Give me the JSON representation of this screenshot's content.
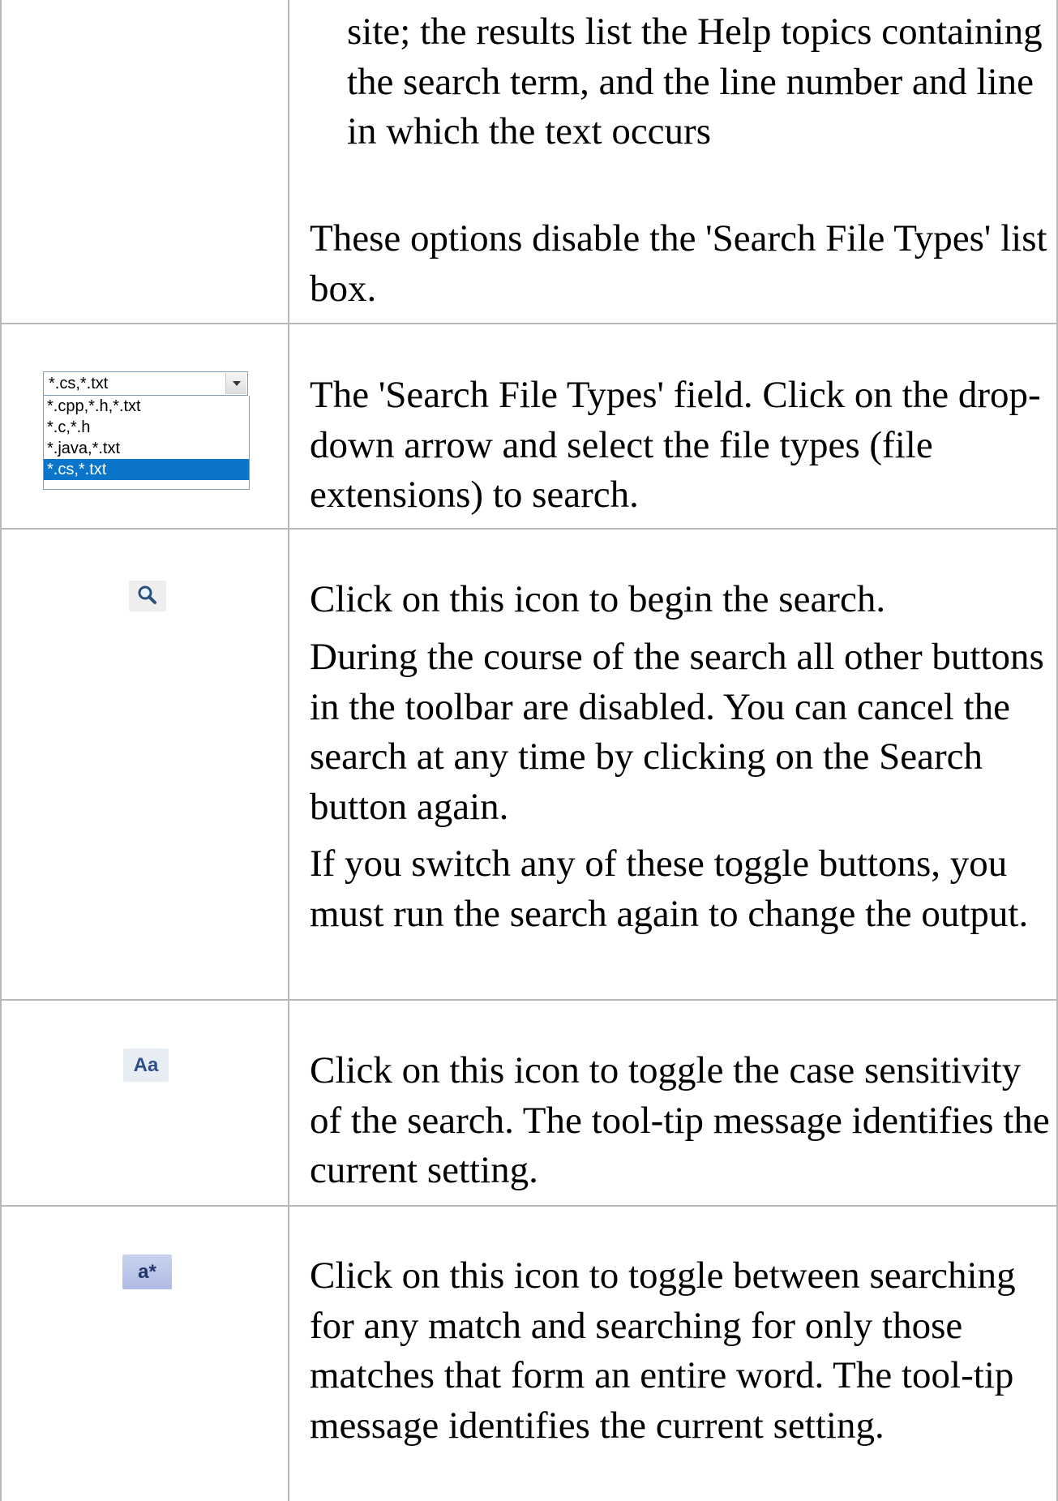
{
  "rows": [
    {
      "paragraphs": [
        "site; the results list the Help topics containing the search term, and the line number and line in which the text occurs",
        "These options disable the 'Search File Types' list box."
      ]
    },
    {
      "icon": {
        "name": "file-types-dropdown",
        "selected_value": "*.cs,*.txt",
        "options": [
          "*.cpp,*.h,*.txt",
          "*.c,*.h",
          "*.java,*.txt",
          "*.cs,*.txt"
        ],
        "highlight_color": "#0a75c9"
      },
      "paragraphs": [
        "The 'Search File Types' field. Click on the drop-down arrow and select the file types (file extensions) to search."
      ]
    },
    {
      "icon": {
        "name": "search-icon"
      },
      "paragraphs": [
        "Click on this icon to begin the search.",
        "During the course of the search all other buttons in the toolbar are disabled. You can cancel the search at any time by clicking on the Search button again.",
        "If you switch any of these toggle buttons, you must run the search again to change the output."
      ]
    },
    {
      "icon": {
        "name": "match-case-icon",
        "glyph": "Aa"
      },
      "paragraphs": [
        "Click on this icon to toggle the case sensitivity of the search. The tool-tip message identifies the current setting."
      ]
    },
    {
      "icon": {
        "name": "whole-word-icon",
        "glyph": "a*"
      },
      "paragraphs": [
        "Click on this icon to toggle between searching for any match and searching for only those matches that form an entire word. The tool-tip message identifies the current setting."
      ]
    }
  ]
}
